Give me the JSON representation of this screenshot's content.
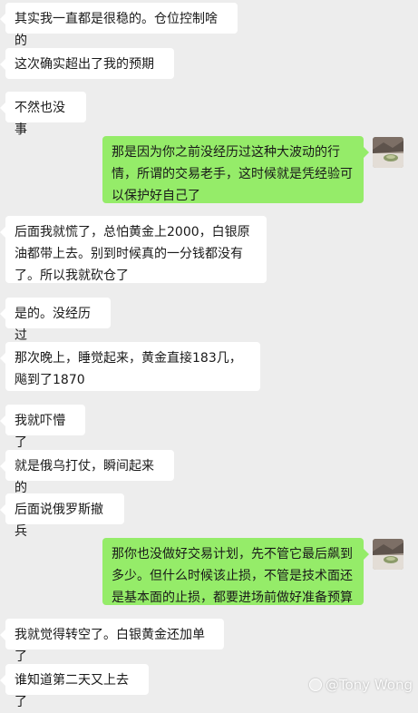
{
  "messages": [
    {
      "side": "left",
      "text": "其实我一直都是很稳的。仓位控制啥的"
    },
    {
      "side": "left",
      "text": "这次确实超出了我的预期"
    },
    {
      "side": "left",
      "text": "不然也没事"
    },
    {
      "side": "right",
      "text": "那是因为你之前没经历过这种大波动的行情，所谓的交易老手，这时候就是凭经验可以保护好自己了"
    },
    {
      "side": "left",
      "text": "后面我就慌了，总怕黄金上2000，白银原油都带上去。别到时候真的一分钱都没有了。所以我就砍仓了"
    },
    {
      "side": "left",
      "text": "是的。没经历过"
    },
    {
      "side": "left",
      "text": "那次晚上，睡觉起来，黄金直接183几，飚到了1870"
    },
    {
      "side": "left",
      "text": "我就吓懵了"
    },
    {
      "side": "left",
      "text": "就是俄乌打仗，瞬间起来的"
    },
    {
      "side": "left",
      "text": "后面说俄罗斯撤兵"
    },
    {
      "side": "right",
      "text": "那你也没做好交易计划，先不管它最后飙到多少。但什么时候该止损，不管是技术面还是基本面的止损，都要进场前做好准备预算"
    },
    {
      "side": "left",
      "text": "我就觉得转空了。白银黄金还加单了"
    },
    {
      "side": "left",
      "text": "谁知道第二天又上去了"
    }
  ],
  "watermark": {
    "text": "@Tony Wong"
  },
  "avatar_icon": "landscape-photo-avatar"
}
